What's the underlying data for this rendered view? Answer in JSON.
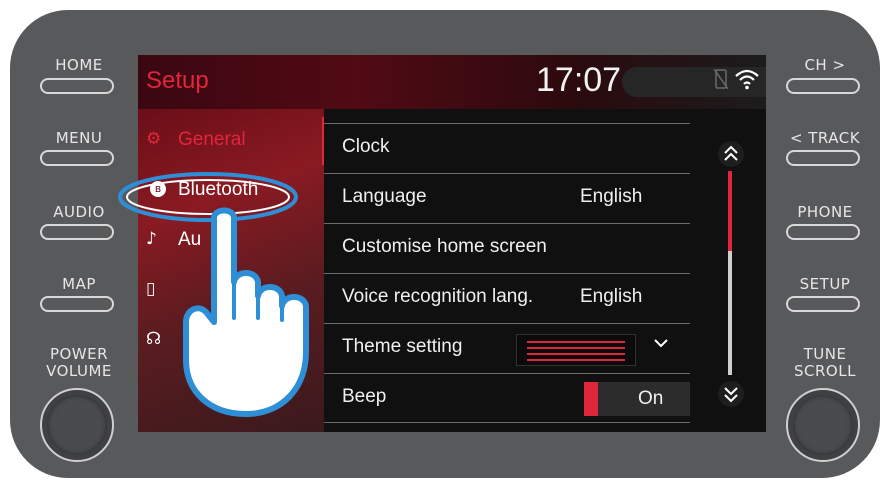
{
  "hardware": {
    "left_buttons": [
      "HOME",
      "MENU",
      "AUDIO",
      "MAP"
    ],
    "right_buttons": [
      "CH >",
      "< TRACK",
      "PHONE",
      "SETUP"
    ],
    "power_volume": [
      "POWER",
      "VOLUME"
    ],
    "tune_scroll": [
      "TUNE",
      "SCROLL"
    ]
  },
  "header": {
    "title": "Setup",
    "time": "17:07"
  },
  "sidebar": {
    "items": [
      {
        "label": "General",
        "icon": "gear-icon",
        "glyph": "⚙"
      },
      {
        "label": "Bluetooth",
        "icon": "bluetooth-icon",
        "glyph": "ʙ"
      },
      {
        "label": "Au",
        "icon": "music-note-icon",
        "glyph": "♪"
      },
      {
        "label": "",
        "icon": "phone-icon",
        "glyph": "▯"
      },
      {
        "label": "",
        "icon": "voice-icon",
        "glyph": "☊"
      }
    ]
  },
  "settings": {
    "rows": [
      {
        "label": "Clock",
        "value": ""
      },
      {
        "label": "Language",
        "value": "English"
      },
      {
        "label": "Customise home screen",
        "value": ""
      },
      {
        "label": "Voice recognition lang.",
        "value": "English"
      },
      {
        "label": "Theme setting",
        "value": ""
      },
      {
        "label": "Beep",
        "value": "On"
      }
    ]
  },
  "scroll": {
    "position_fraction": 0.3
  },
  "colors": {
    "accent": "#e0263c",
    "highlight_ring": "#2f8fd6",
    "bezel": "#58595b"
  }
}
